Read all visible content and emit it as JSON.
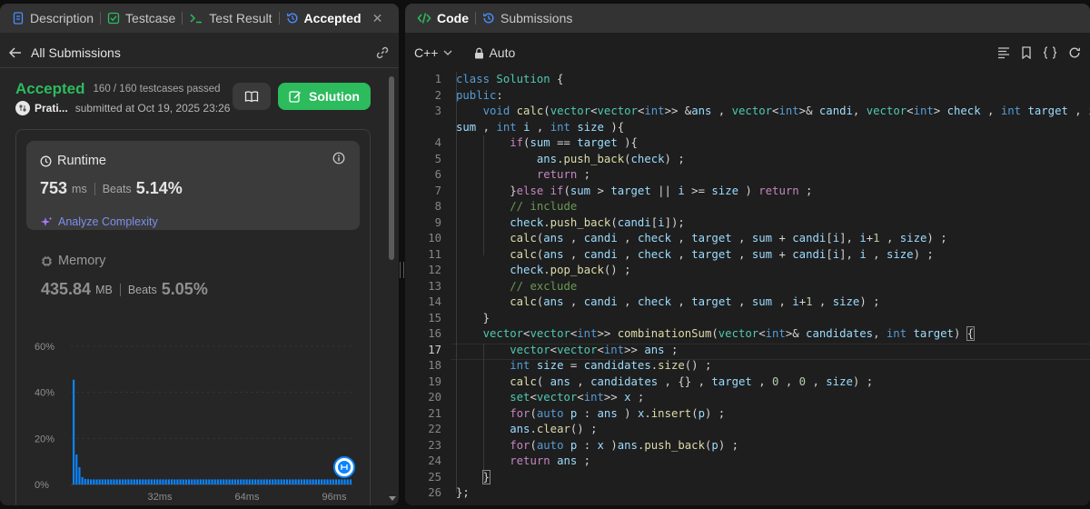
{
  "left_tabs": [
    {
      "label": "Description",
      "icon": "document-icon"
    },
    {
      "label": "Testcase",
      "icon": "checkbox-icon"
    },
    {
      "label": "Test Result",
      "icon": "terminal-icon"
    },
    {
      "label": "Accepted",
      "icon": "history-icon"
    }
  ],
  "all_submissions": "All Submissions",
  "status": {
    "label": "Accepted",
    "testcases": "160 / 160 testcases passed"
  },
  "byline": {
    "user": "Prati...",
    "submitted": "submitted at Oct 19, 2025 23:26"
  },
  "solution_button": "Solution",
  "runtime": {
    "title": "Runtime",
    "value": "753",
    "unit": "ms",
    "beats_label": "Beats",
    "beats": "5.14%",
    "analyze": "Analyze Complexity"
  },
  "memory": {
    "title": "Memory",
    "value": "435.84",
    "unit": "MB",
    "beats_label": "Beats",
    "beats": "5.05%"
  },
  "chart_data": {
    "type": "bar",
    "y_ticks": [
      "60%",
      "40%",
      "20%",
      "0%"
    ],
    "x_ticks": [
      "32ms",
      "64ms",
      "96ms"
    ],
    "ylim": [
      0,
      60
    ],
    "values": [
      45.5,
      13,
      7.5,
      3.2,
      2.4,
      2.3,
      2.2,
      2.2,
      2.2,
      2.2,
      2.2,
      2.2,
      2.2,
      2.2,
      2.2,
      2.2,
      2.2,
      2.2,
      2.2,
      2.2,
      2.2,
      2.2,
      2.2,
      2.2,
      2.2,
      2.2,
      2.2,
      2.2,
      2.2,
      2.2,
      2.2,
      2.2,
      2.2,
      2.2,
      2.2,
      2.2,
      2.2,
      2.2,
      2.2,
      2.2,
      2.2,
      2.2,
      2.2,
      2.2,
      2.2,
      2.2,
      2.2,
      2.2,
      2.2,
      2.2,
      2.2,
      2.2,
      2.2,
      2.2,
      2.2,
      2.2,
      2.2,
      2.2,
      2.2,
      2.2,
      2.2,
      2.2,
      2.2,
      2.2,
      2.2,
      2.2,
      2.2,
      2.2,
      2.2,
      2.2,
      2.2,
      2.2,
      2.2,
      2.2,
      2.2,
      2.2,
      2.2,
      2.2,
      2.2,
      2.2,
      2.2,
      2.2,
      2.2,
      2.2,
      2.2,
      2.2,
      2.2,
      2.2,
      2.2,
      2.2,
      2.2,
      2.2,
      2.2,
      2.2,
      2.2,
      2.2,
      2.2
    ],
    "bar_color": "#0a84ff"
  },
  "right_tabs": [
    {
      "label": "Code",
      "icon": "code-icon"
    },
    {
      "label": "Submissions",
      "icon": "history-icon"
    }
  ],
  "editor": {
    "language": "C++",
    "mode": "Auto",
    "current_line": 17
  },
  "code_lines": [
    {
      "n": "1",
      "t": [
        [
          "k",
          "class "
        ],
        [
          "ty",
          "Solution"
        ],
        [
          "pl",
          " {"
        ]
      ]
    },
    {
      "n": "2",
      "t": [
        [
          "k",
          "public"
        ],
        [
          "pl",
          ":"
        ]
      ]
    },
    {
      "n": "3",
      "t": [
        [
          "pl",
          "    "
        ],
        [
          "k",
          "void "
        ],
        [
          "f",
          "calc"
        ],
        [
          "pl",
          "("
        ],
        [
          "ty",
          "vector"
        ],
        [
          "pl",
          "<"
        ],
        [
          "ty",
          "vector"
        ],
        [
          "pl",
          "<"
        ],
        [
          "k",
          "int"
        ],
        [
          "pl",
          ">> &"
        ],
        [
          "v",
          "ans"
        ],
        [
          "pl",
          " , "
        ],
        [
          "ty",
          "vector"
        ],
        [
          "pl",
          "<"
        ],
        [
          "k",
          "int"
        ],
        [
          "pl",
          ">& "
        ],
        [
          "v",
          "candi"
        ],
        [
          "pl",
          ", "
        ],
        [
          "ty",
          "vector"
        ],
        [
          "pl",
          "<"
        ],
        [
          "k",
          "int"
        ],
        [
          "pl",
          "> "
        ],
        [
          "v",
          "check"
        ],
        [
          "pl",
          " , "
        ],
        [
          "k",
          "int "
        ],
        [
          "v",
          "target"
        ],
        [
          "pl",
          " , "
        ],
        [
          "k",
          "int"
        ]
      ]
    },
    {
      "n": "",
      "t": [
        [
          "v",
          "sum"
        ],
        [
          "pl",
          " , "
        ],
        [
          "k",
          "int "
        ],
        [
          "v",
          "i"
        ],
        [
          "pl",
          " , "
        ],
        [
          "k",
          "int "
        ],
        [
          "v",
          "size"
        ],
        [
          "pl",
          " ){"
        ]
      ]
    },
    {
      "n": "4",
      "t": [
        [
          "pl",
          "        "
        ],
        [
          "p",
          "if"
        ],
        [
          "pl",
          "("
        ],
        [
          "v",
          "sum"
        ],
        [
          "pl",
          " == "
        ],
        [
          "v",
          "target"
        ],
        [
          "pl",
          " ){"
        ]
      ]
    },
    {
      "n": "5",
      "t": [
        [
          "pl",
          "            "
        ],
        [
          "v",
          "ans"
        ],
        [
          "pl",
          "."
        ],
        [
          "f",
          "push_back"
        ],
        [
          "pl",
          "("
        ],
        [
          "v",
          "check"
        ],
        [
          "pl",
          ") ;"
        ]
      ]
    },
    {
      "n": "6",
      "t": [
        [
          "pl",
          "            "
        ],
        [
          "p",
          "return"
        ],
        [
          "pl",
          " ;"
        ]
      ]
    },
    {
      "n": "7",
      "t": [
        [
          "pl",
          "        }"
        ],
        [
          "p",
          "else if"
        ],
        [
          "pl",
          "("
        ],
        [
          "v",
          "sum"
        ],
        [
          "pl",
          " > "
        ],
        [
          "v",
          "target"
        ],
        [
          "pl",
          " || "
        ],
        [
          "v",
          "i"
        ],
        [
          "pl",
          " >= "
        ],
        [
          "v",
          "size"
        ],
        [
          "pl",
          " ) "
        ],
        [
          "p",
          "return"
        ],
        [
          "pl",
          " ;"
        ]
      ]
    },
    {
      "n": "8",
      "t": [
        [
          "pl",
          "        "
        ],
        [
          "c",
          "// include"
        ]
      ]
    },
    {
      "n": "9",
      "t": [
        [
          "pl",
          "        "
        ],
        [
          "v",
          "check"
        ],
        [
          "pl",
          "."
        ],
        [
          "f",
          "push_back"
        ],
        [
          "pl",
          "("
        ],
        [
          "v",
          "candi"
        ],
        [
          "pl",
          "["
        ],
        [
          "v",
          "i"
        ],
        [
          "pl",
          "]);"
        ]
      ]
    },
    {
      "n": "10",
      "t": [
        [
          "pl",
          "        "
        ],
        [
          "f",
          "calc"
        ],
        [
          "pl",
          "("
        ],
        [
          "v",
          "ans"
        ],
        [
          "pl",
          " , "
        ],
        [
          "v",
          "candi"
        ],
        [
          "pl",
          " , "
        ],
        [
          "v",
          "check"
        ],
        [
          "pl",
          " , "
        ],
        [
          "v",
          "target"
        ],
        [
          "pl",
          " , "
        ],
        [
          "v",
          "sum"
        ],
        [
          "pl",
          " + "
        ],
        [
          "v",
          "candi"
        ],
        [
          "pl",
          "["
        ],
        [
          "v",
          "i"
        ],
        [
          "pl",
          "], "
        ],
        [
          "v",
          "i"
        ],
        [
          "pl",
          "+"
        ],
        [
          "n",
          "1"
        ],
        [
          "pl",
          " , "
        ],
        [
          "v",
          "size"
        ],
        [
          "pl",
          ") ;"
        ]
      ]
    },
    {
      "n": "11",
      "t": [
        [
          "pl",
          "        "
        ],
        [
          "f",
          "calc"
        ],
        [
          "pl",
          "("
        ],
        [
          "v",
          "ans"
        ],
        [
          "pl",
          " , "
        ],
        [
          "v",
          "candi"
        ],
        [
          "pl",
          " , "
        ],
        [
          "v",
          "check"
        ],
        [
          "pl",
          " , "
        ],
        [
          "v",
          "target"
        ],
        [
          "pl",
          " , "
        ],
        [
          "v",
          "sum"
        ],
        [
          "pl",
          " + "
        ],
        [
          "v",
          "candi"
        ],
        [
          "pl",
          "["
        ],
        [
          "v",
          "i"
        ],
        [
          "pl",
          "], "
        ],
        [
          "v",
          "i"
        ],
        [
          "pl",
          " , "
        ],
        [
          "v",
          "size"
        ],
        [
          "pl",
          ") ;"
        ]
      ]
    },
    {
      "n": "12",
      "t": [
        [
          "pl",
          "        "
        ],
        [
          "v",
          "check"
        ],
        [
          "pl",
          "."
        ],
        [
          "f",
          "pop_back"
        ],
        [
          "pl",
          "() ;"
        ]
      ]
    },
    {
      "n": "13",
      "t": [
        [
          "pl",
          "        "
        ],
        [
          "c",
          "// exclude"
        ]
      ]
    },
    {
      "n": "14",
      "t": [
        [
          "pl",
          "        "
        ],
        [
          "f",
          "calc"
        ],
        [
          "pl",
          "("
        ],
        [
          "v",
          "ans"
        ],
        [
          "pl",
          " , "
        ],
        [
          "v",
          "candi"
        ],
        [
          "pl",
          " , "
        ],
        [
          "v",
          "check"
        ],
        [
          "pl",
          " , "
        ],
        [
          "v",
          "target"
        ],
        [
          "pl",
          " , "
        ],
        [
          "v",
          "sum"
        ],
        [
          "pl",
          " , "
        ],
        [
          "v",
          "i"
        ],
        [
          "pl",
          "+"
        ],
        [
          "n",
          "1"
        ],
        [
          "pl",
          " , "
        ],
        [
          "v",
          "size"
        ],
        [
          "pl",
          ") ;"
        ]
      ]
    },
    {
      "n": "15",
      "t": [
        [
          "pl",
          "    }"
        ]
      ]
    },
    {
      "n": "16",
      "t": [
        [
          "pl",
          "    "
        ],
        [
          "ty",
          "vector"
        ],
        [
          "pl",
          "<"
        ],
        [
          "ty",
          "vector"
        ],
        [
          "pl",
          "<"
        ],
        [
          "k",
          "int"
        ],
        [
          "pl",
          ">> "
        ],
        [
          "f",
          "combinationSum"
        ],
        [
          "pl",
          "("
        ],
        [
          "ty",
          "vector"
        ],
        [
          "pl",
          "<"
        ],
        [
          "k",
          "int"
        ],
        [
          "pl",
          ">& "
        ],
        [
          "v",
          "candidates"
        ],
        [
          "pl",
          ", "
        ],
        [
          "k",
          "int "
        ],
        [
          "v",
          "target"
        ],
        [
          "pl",
          ") "
        ],
        [
          "bk",
          "{"
        ]
      ]
    },
    {
      "n": "17",
      "t": [
        [
          "pl",
          "        "
        ],
        [
          "ty",
          "vector"
        ],
        [
          "pl",
          "<"
        ],
        [
          "ty",
          "vector"
        ],
        [
          "pl",
          "<"
        ],
        [
          "k",
          "int"
        ],
        [
          "pl",
          ">> "
        ],
        [
          "v",
          "ans"
        ],
        [
          "pl",
          " ;"
        ]
      ]
    },
    {
      "n": "18",
      "t": [
        [
          "pl",
          "        "
        ],
        [
          "k",
          "int "
        ],
        [
          "v",
          "size"
        ],
        [
          "pl",
          " = "
        ],
        [
          "v",
          "candidates"
        ],
        [
          "pl",
          "."
        ],
        [
          "f",
          "size"
        ],
        [
          "pl",
          "() ;"
        ]
      ]
    },
    {
      "n": "19",
      "t": [
        [
          "pl",
          "        "
        ],
        [
          "f",
          "calc"
        ],
        [
          "pl",
          "( "
        ],
        [
          "v",
          "ans"
        ],
        [
          "pl",
          " , "
        ],
        [
          "v",
          "candidates"
        ],
        [
          "pl",
          " , {} , "
        ],
        [
          "v",
          "target"
        ],
        [
          "pl",
          " , "
        ],
        [
          "n",
          "0"
        ],
        [
          "pl",
          " , "
        ],
        [
          "n",
          "0"
        ],
        [
          "pl",
          " , "
        ],
        [
          "v",
          "size"
        ],
        [
          "pl",
          ") ;"
        ]
      ]
    },
    {
      "n": "20",
      "t": [
        [
          "pl",
          "        "
        ],
        [
          "ty",
          "set"
        ],
        [
          "pl",
          "<"
        ],
        [
          "ty",
          "vector"
        ],
        [
          "pl",
          "<"
        ],
        [
          "k",
          "int"
        ],
        [
          "pl",
          ">> "
        ],
        [
          "v",
          "x"
        ],
        [
          "pl",
          " ;"
        ]
      ]
    },
    {
      "n": "21",
      "t": [
        [
          "pl",
          "        "
        ],
        [
          "p",
          "for"
        ],
        [
          "pl",
          "("
        ],
        [
          "k",
          "auto "
        ],
        [
          "v",
          "p"
        ],
        [
          "pl",
          " : "
        ],
        [
          "v",
          "ans"
        ],
        [
          "pl",
          " ) "
        ],
        [
          "v",
          "x"
        ],
        [
          "pl",
          "."
        ],
        [
          "f",
          "insert"
        ],
        [
          "pl",
          "("
        ],
        [
          "v",
          "p"
        ],
        [
          "pl",
          ") ;"
        ]
      ]
    },
    {
      "n": "22",
      "t": [
        [
          "pl",
          "        "
        ],
        [
          "v",
          "ans"
        ],
        [
          "pl",
          "."
        ],
        [
          "f",
          "clear"
        ],
        [
          "pl",
          "() ;"
        ]
      ]
    },
    {
      "n": "23",
      "t": [
        [
          "pl",
          "        "
        ],
        [
          "p",
          "for"
        ],
        [
          "pl",
          "("
        ],
        [
          "k",
          "auto "
        ],
        [
          "v",
          "p"
        ],
        [
          "pl",
          " : "
        ],
        [
          "v",
          "x"
        ],
        [
          "pl",
          " )"
        ],
        [
          "v",
          "ans"
        ],
        [
          "pl",
          "."
        ],
        [
          "f",
          "push_back"
        ],
        [
          "pl",
          "("
        ],
        [
          "v",
          "p"
        ],
        [
          "pl",
          ") ;"
        ]
      ]
    },
    {
      "n": "24",
      "t": [
        [
          "pl",
          "        "
        ],
        [
          "p",
          "return"
        ],
        [
          "pl",
          " "
        ],
        [
          "v",
          "ans"
        ],
        [
          "pl",
          " ;"
        ]
      ]
    },
    {
      "n": "25",
      "t": [
        [
          "pl",
          "    "
        ],
        [
          "bk",
          "}"
        ]
      ]
    },
    {
      "n": "26",
      "t": [
        [
          "pl",
          "};"
        ]
      ]
    }
  ]
}
